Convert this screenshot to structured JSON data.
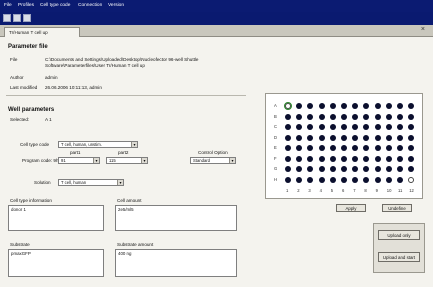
{
  "menu": [
    "File",
    "Profiles",
    "Cell type code",
    "Connection",
    "Version"
  ],
  "tab": {
    "label": "Tr/Human T cell up"
  },
  "parameter_file": {
    "title": "Parameter file",
    "file_label": "File",
    "file_value": "C:\\Documents and Settings\\Uploaded\\Desktop\\Nucleofector 96-well Shuttle Software\\Parameterfiles\\User Tr/Human T cell up",
    "author_label": "Author",
    "author_value": "admin",
    "modified_label": "Last modified",
    "modified_value": "26.06.2006 10:11:13, admin"
  },
  "well_parameters": {
    "title": "Well parameters",
    "selected_label": "Selected:",
    "selected_value": "A 1",
    "cell_type_label": "Cell type code",
    "cell_type_value": "T cell, human, unstim.",
    "part1_label": "part1",
    "part2_label": "part2",
    "program_label": "Program code: 9h",
    "program_part1": "91",
    "program_part2": "115",
    "control_label": "Control Option",
    "control_value": "Standard",
    "solution_label": "Solution",
    "solution_value": "T cell, human",
    "cell_info_label": "Cell type information",
    "cell_info_value": "donor 1",
    "cell_amount_label": "Cell amount",
    "cell_amount_value": "2e5/ml5",
    "substrate_label": "Substrate",
    "substrate_value": "pmaxGFP",
    "substrate_amount_label": "Substrate amount",
    "substrate_amount_value": "400 ng"
  },
  "plate": {
    "rows": [
      "A",
      "B",
      "C",
      "D",
      "E",
      "F",
      "G",
      "H"
    ],
    "cols": [
      "1",
      "2",
      "3",
      "4",
      "5",
      "6",
      "7",
      "8",
      "9",
      "10",
      "11",
      "12"
    ],
    "selected_well": "A1",
    "empty_wells": [
      "A1",
      "H12"
    ],
    "apply_label": "Apply",
    "undefine_label": "Undefine"
  },
  "upload": {
    "upload_only_label": "Upload only",
    "upload_start_label": "Upload and start"
  }
}
